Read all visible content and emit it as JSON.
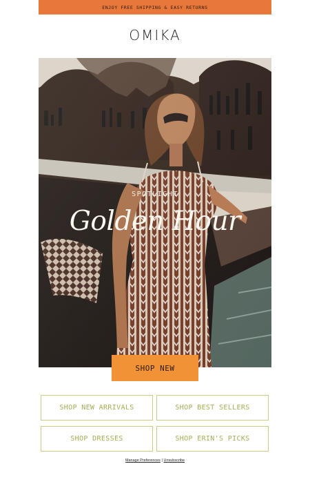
{
  "promo": {
    "text": "ENJOY FREE SHIPPING & EASY RETURNS"
  },
  "brand": {
    "name": "OMIKA"
  },
  "hero": {
    "eyebrow": "SPOTLIGHT",
    "title": "Golden Hour"
  },
  "cta": {
    "label": "SHOP NEW"
  },
  "shop_links": [
    {
      "label": "SHOP NEW ARRIVALS"
    },
    {
      "label": "SHOP BEST SELLERS"
    },
    {
      "label": "SHOP DRESSES"
    },
    {
      "label": "SHOP ERIN'S PICKS"
    }
  ],
  "footer": {
    "manage_label": "Manage Preferences",
    "separator": "|",
    "unsubscribe_label": "Unsubscribe"
  },
  "colors": {
    "promo_bar": "#e8773a",
    "cta": "#f19236",
    "link_border": "#c9cb86",
    "link_text": "#a8ad55"
  }
}
